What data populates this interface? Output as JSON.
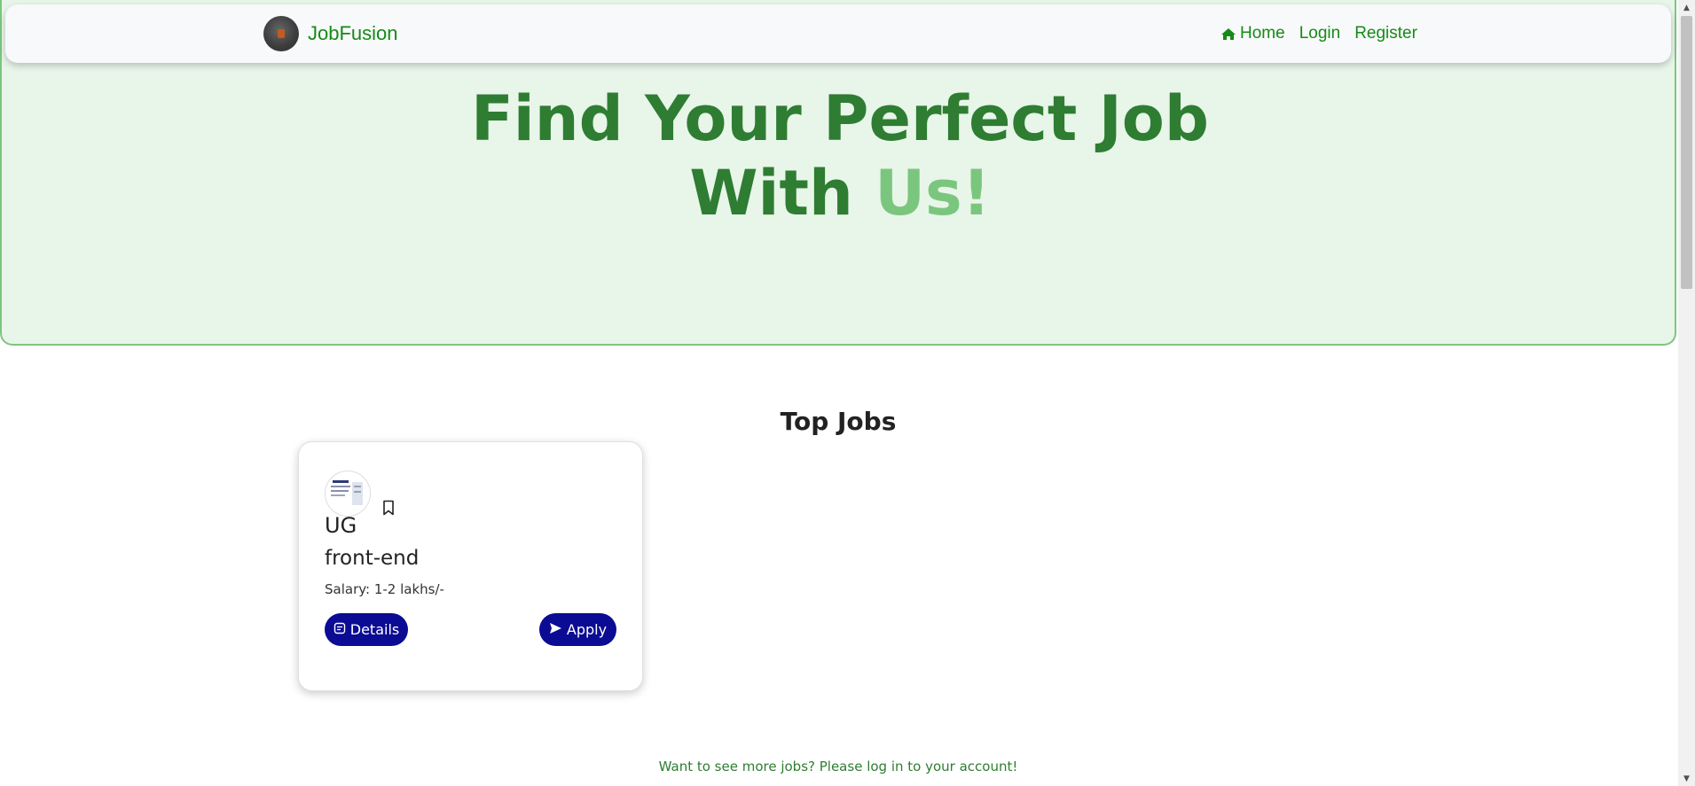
{
  "app": {
    "brand_name": "JobFusion"
  },
  "nav": {
    "items": [
      {
        "label": "Home",
        "icon": "home-icon"
      },
      {
        "label": "Login"
      },
      {
        "label": "Register"
      }
    ]
  },
  "hero": {
    "line1": "Find Your Perfect Job",
    "line2_prefix": "With ",
    "line2_accent": "Us!"
  },
  "top_jobs": {
    "title": "Top Jobs",
    "jobs": [
      {
        "level": "UG",
        "role": "front-end",
        "salary": "Salary: 1-2 lakhs/-",
        "details_label": "Details",
        "apply_label": "Apply",
        "icons": {
          "bookmark": "bookmark-icon",
          "details": "document-icon",
          "apply": "send-icon"
        }
      }
    ]
  },
  "footer": {
    "login_prompt": "Want to see more jobs? Please log in to your account!"
  },
  "colors": {
    "brand_green": "#168a16",
    "hero_bg": "#e8f5e9",
    "hero_title": "#2e7d32",
    "hero_accent": "#7bc67e",
    "button_bg": "#0b0b94"
  }
}
